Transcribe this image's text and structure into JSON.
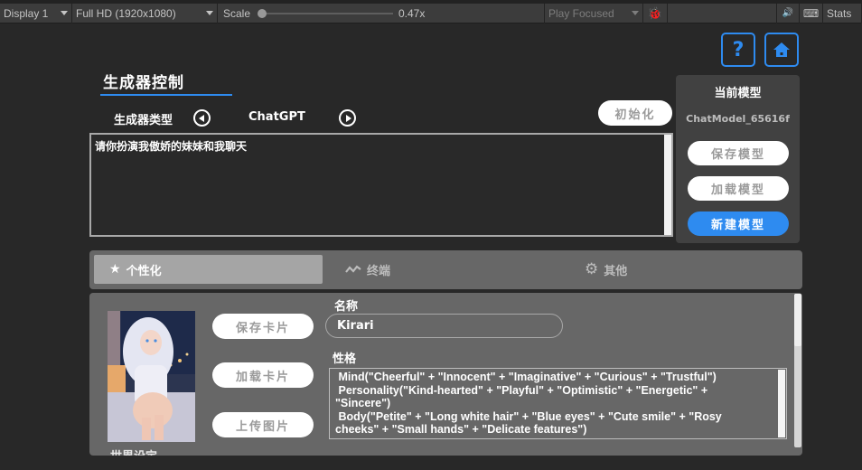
{
  "toolbar": {
    "display": "Display 1",
    "resolution": "Full HD (1920x1080)",
    "scale_label": "Scale",
    "scale_value": "0.47x",
    "scale_fraction": 0.0,
    "play_mode": "Play Focused",
    "stats_label": "Stats"
  },
  "header": {
    "help_symbol": "?",
    "home_symbol": "⌂"
  },
  "generator": {
    "section_title": "生成器控制",
    "type_label": "生成器类型",
    "type_value": "ChatGPT",
    "init_button": "初始化",
    "prompt_text": "请你扮演我傲娇的妹妹和我聊天"
  },
  "model_panel": {
    "title": "当前模型",
    "model_name": "ChatModel_65616f",
    "save_button": "保存模型",
    "load_button": "加载模型",
    "new_button": "新建模型"
  },
  "tabs": [
    {
      "label": "个性化",
      "icon": "star-icon",
      "active": true
    },
    {
      "label": "终端",
      "icon": "wave-icon",
      "active": false
    },
    {
      "label": "其他",
      "icon": "gear-icon",
      "active": false
    }
  ],
  "card": {
    "save_card": "保存卡片",
    "load_card": "加载卡片",
    "upload_image": "上传图片",
    "name_label": "名称",
    "name_value": "Kirari",
    "personality_label": "性格",
    "personality_value": " Mind(\"Cheerful\" + \"Innocent\" + \"Imaginative\" + \"Curious\" + \"Trustful\")\n Personality(\"Kind-hearted\" + \"Playful\" + \"Optimistic\" + \"Energetic\" +\n\"Sincere\")\n Body(\"Petite\" + \"Long white hair\" + \"Blue eyes\" + \"Cute smile\" + \"Rosy\ncheeks\" + \"Small hands\" + \"Delicate features\")",
    "world_label": "世界设定"
  },
  "colors": {
    "accent": "#2e8bf0",
    "panel": "#676767",
    "background": "#282828"
  }
}
